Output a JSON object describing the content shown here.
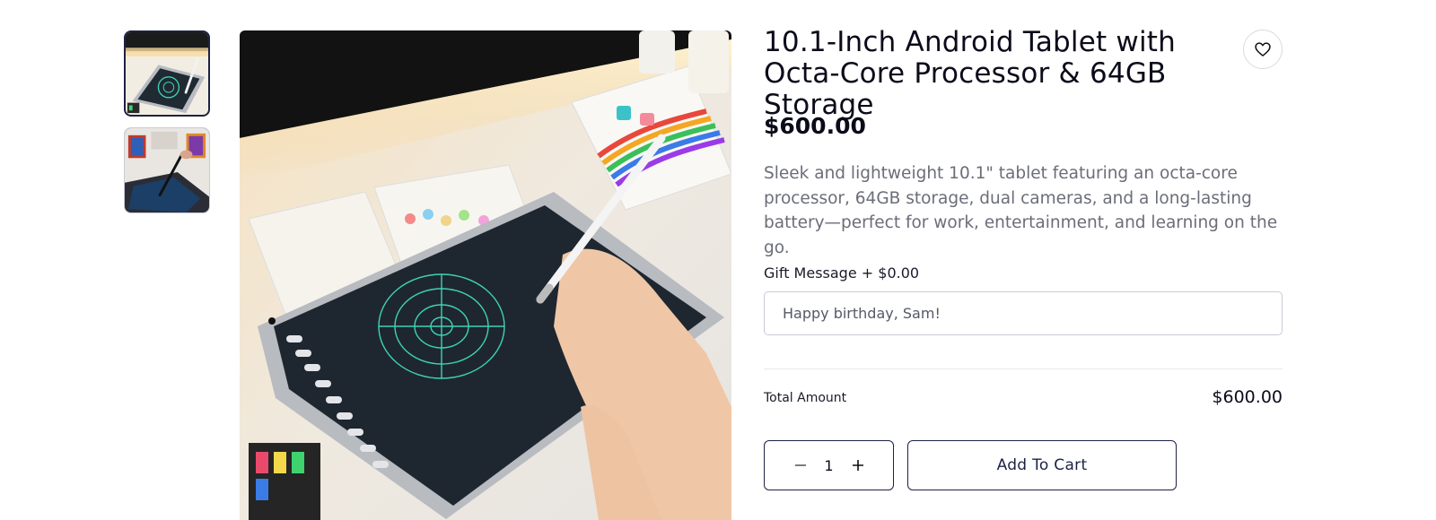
{
  "product": {
    "title": "10.1-Inch Android Tablet with Octa-Core Processor & 64GB Storage",
    "price": "$600.00",
    "description": "Sleek and lightweight 10.1\" tablet featuring an octa-core processor, 64GB storage, dual cameras, and a long-lasting battery—perfect for work, entertainment, and learning on the go."
  },
  "gallery": {
    "thumbnails": [
      {
        "name": "tablet-drawing-photo",
        "active": true
      },
      {
        "name": "tablet-art-photo",
        "active": false
      }
    ],
    "main_image": "tablet-drawing-photo"
  },
  "icons": {
    "wishlist": "heart-icon",
    "decrease": "minus-icon",
    "increase": "plus-icon"
  },
  "gift": {
    "label": "Gift Message + $0.00",
    "placeholder": "Happy birthday, Sam!"
  },
  "total": {
    "label": "Total Amount",
    "value": "$600.00"
  },
  "cart": {
    "quantity": "1",
    "add_label": "Add To Cart"
  },
  "colors": {
    "accent": "#1d2244",
    "text": "#0b0b1a",
    "muted": "#6b6d78",
    "border": "#c9cbd6"
  }
}
